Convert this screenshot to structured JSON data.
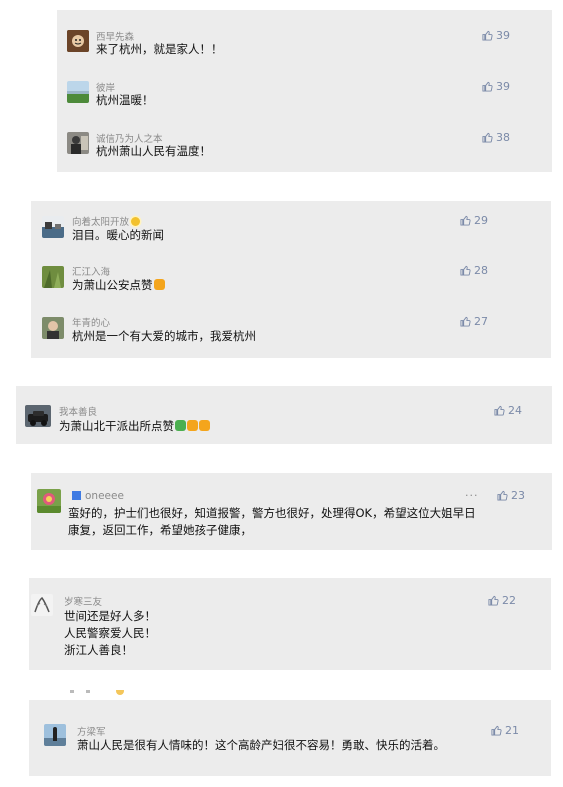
{
  "comments": [
    {
      "name": "西早先森",
      "text": "来了杭州，就是家人！！",
      "likes": "39"
    },
    {
      "name": "彼岸",
      "text": "杭州温暖！",
      "likes": "39"
    },
    {
      "name": "诚信乃为人之本",
      "text": "杭州萧山人民有温度！",
      "likes": "38"
    },
    {
      "name": "向着太阳开放",
      "text": "泪目。暖心的新闻",
      "likes": "29"
    },
    {
      "name": "汇江入海",
      "text": "为萧山公安点赞",
      "likes": "28"
    },
    {
      "name": "年青的心",
      "text": "杭州是一个有大爱的城市，我爱杭州",
      "likes": "27"
    },
    {
      "name": "我本善良",
      "text": "为萧山北干派出所点赞",
      "likes": "24"
    },
    {
      "name": "oneeee",
      "text_line1": "蛮好的，护士们也很好，知道报警，警方也很好，处理得OK，希望这位大姐早日",
      "text_line2": "康复，返回工作，希望她孩子健康，",
      "likes": "23",
      "more": "···"
    },
    {
      "name": "岁寒三友",
      "text_line1": "世间还是好人多！",
      "text_line2": "人民警察爱人民！",
      "text_line3": "浙江人善良！",
      "likes": "22"
    },
    {
      "name": "方梁军",
      "text": "萧山人民是很有人情味的！这个高龄产妇很不容易！勇敢、快乐的活着。",
      "likes": "21"
    }
  ],
  "colors": {
    "card_bg": "#ececec",
    "like_color": "#7b8aa8",
    "name_color": "#8a8a8a"
  },
  "icons": {
    "like": "thumbs-up-outline-icon",
    "sun": "sun-emoji-icon",
    "thumb": "thumbs-up-emoji-icon",
    "badge": "blue-badge-icon"
  }
}
